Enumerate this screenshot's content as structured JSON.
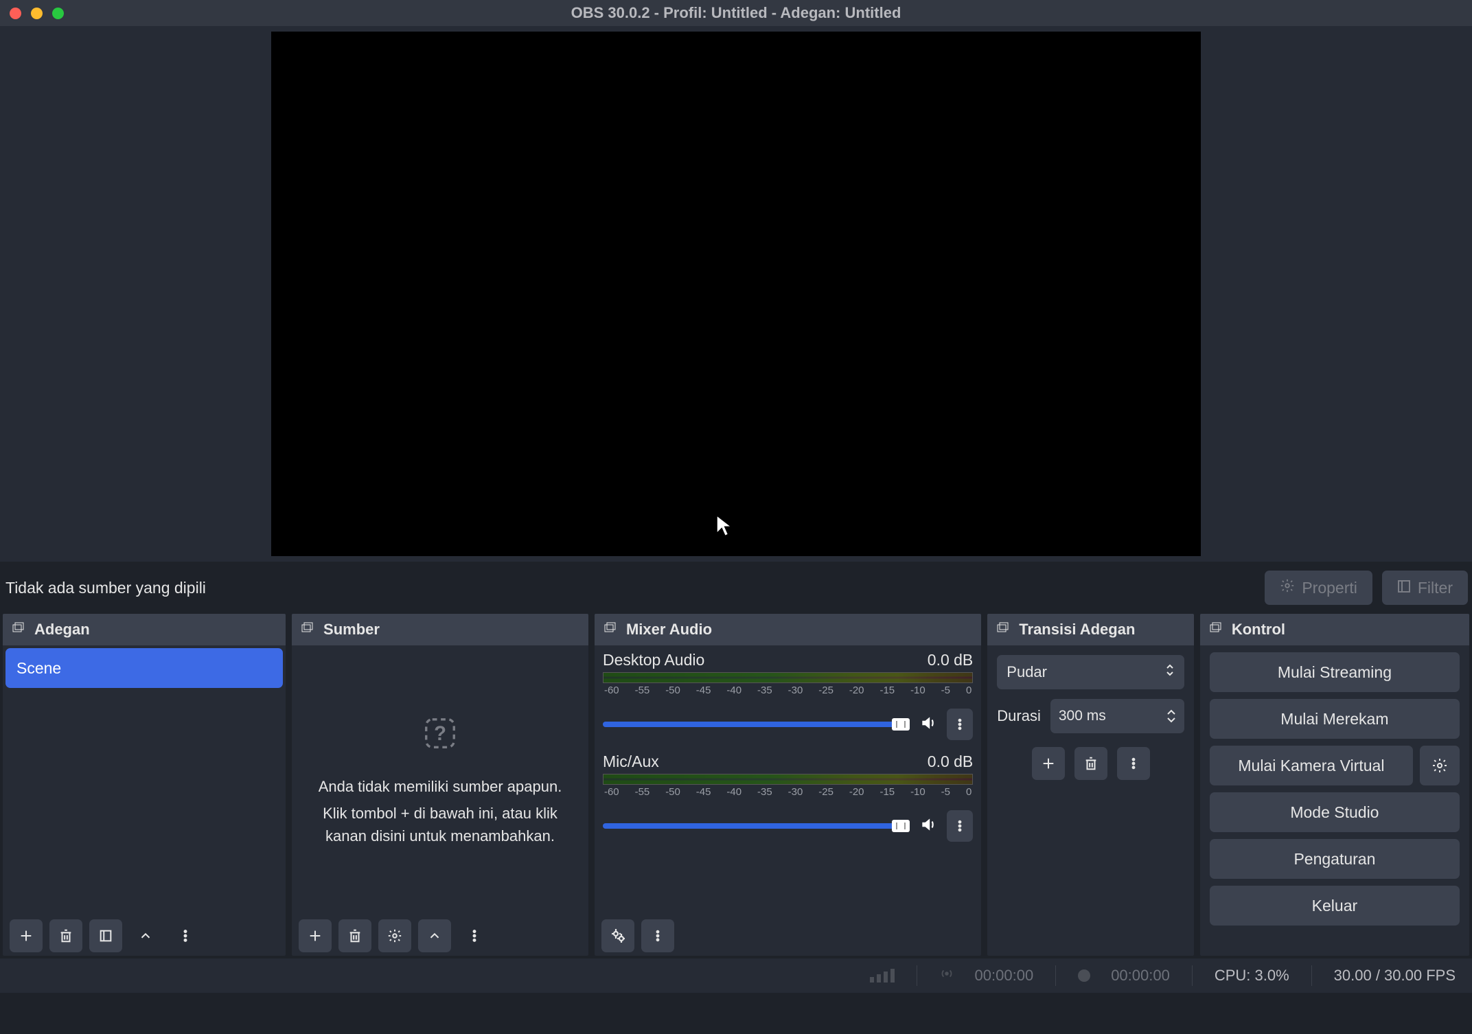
{
  "title": "OBS 30.0.2 - Profil: Untitled - Adegan: Untitled",
  "propbar": {
    "message": "Tidak ada sumber yang dipili",
    "properti": "Properti",
    "filter": "Filter"
  },
  "docks": {
    "adegan": {
      "title": "Adegan",
      "scene": "Scene"
    },
    "sumber": {
      "title": "Sumber",
      "empty_l1": "Anda tidak memiliki sumber apapun.",
      "empty_l2": "Klik tombol + di bawah ini, atau klik kanan disini untuk menambahkan."
    },
    "mixer": {
      "title": "Mixer Audio",
      "tracks": [
        {
          "name": "Desktop Audio",
          "db": "0.0 dB"
        },
        {
          "name": "Mic/Aux",
          "db": "0.0 dB"
        }
      ],
      "scale": [
        "-60",
        "-55",
        "-50",
        "-45",
        "-40",
        "-35",
        "-30",
        "-25",
        "-20",
        "-15",
        "-10",
        "-5",
        "0"
      ]
    },
    "transisi": {
      "title": "Transisi Adegan",
      "selected": "Pudar",
      "durasi_label": "Durasi",
      "durasi_value": "300 ms"
    },
    "kontrol": {
      "title": "Kontrol",
      "buttons": [
        "Mulai Streaming",
        "Mulai Merekam",
        "Mulai Kamera Virtual",
        "Mode Studio",
        "Pengaturan",
        "Keluar"
      ]
    }
  },
  "status": {
    "stream_time": "00:00:00",
    "rec_time": "00:00:00",
    "cpu": "CPU: 3.0%",
    "fps": "30.00 / 30.00 FPS"
  }
}
